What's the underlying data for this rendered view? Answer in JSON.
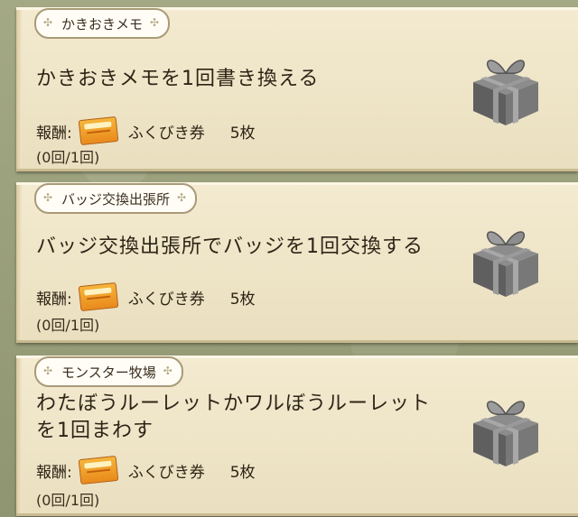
{
  "missions": [
    {
      "category": "かきおきメモ",
      "title_lines": [
        "かきおきメモを1回書き換える"
      ],
      "reward_label": "報酬:",
      "reward_item": "ふくびき券",
      "reward_qty": "5枚",
      "progress": "(0回/1回)",
      "icon": "gift-box-icon"
    },
    {
      "category": "バッジ交換出張所",
      "title_lines": [
        "バッジ交換出張所でバッジを1回交換する"
      ],
      "reward_label": "報酬:",
      "reward_item": "ふくびき券",
      "reward_qty": "5枚",
      "progress": "(0回/1回)",
      "icon": "gift-box-icon"
    },
    {
      "category": "モンスター牧場",
      "title_lines": [
        "わたぼうルーレットかワルぼうルーレット",
        "を1回まわす"
      ],
      "reward_label": "報酬:",
      "reward_item": "ふくびき券",
      "reward_qty": "5枚",
      "progress": "(0回/1回)",
      "icon": "gift-box-icon"
    }
  ]
}
